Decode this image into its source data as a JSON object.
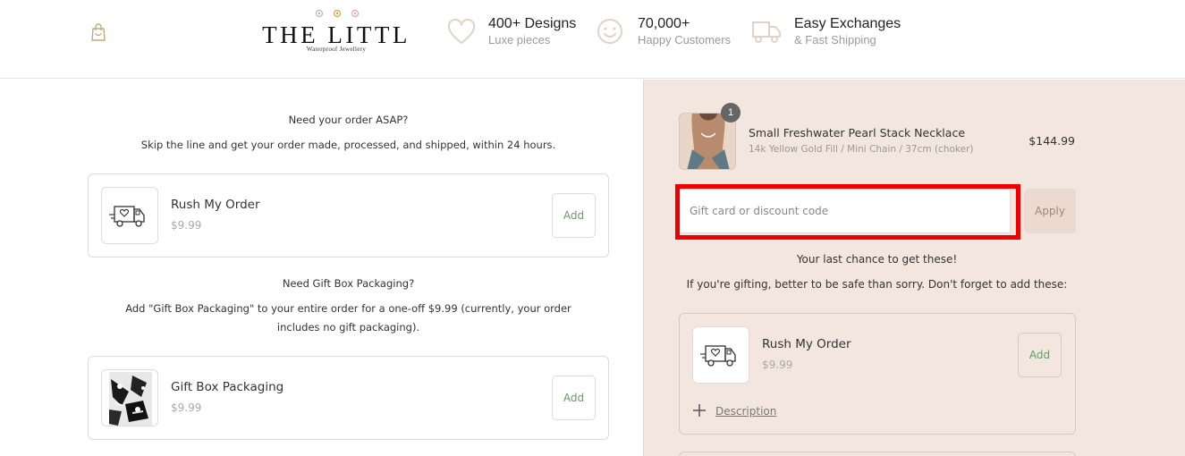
{
  "header": {
    "logo": {
      "wordmark": "THE LITTL",
      "tagline": "Waterproof Jewellery"
    },
    "features": [
      {
        "icon": "heart-icon",
        "title": "400+ Designs",
        "subtitle": "Luxe pieces"
      },
      {
        "icon": "smiley-icon",
        "title": "70,000+",
        "subtitle": "Happy Customers"
      },
      {
        "icon": "truck-icon",
        "title": "Easy Exchanges",
        "subtitle": "& Fast Shipping"
      }
    ]
  },
  "left": {
    "rush_heading": "Need your order ASAP?",
    "rush_text": "Skip the line and get your order made, processed, and shipped, within 24 hours.",
    "rush_item": {
      "name": "Rush My Order",
      "price": "$9.99",
      "add_label": "Add"
    },
    "gift_heading": "Need Gift Box Packaging?",
    "gift_text": "Add \"Gift Box Packaging\" to your entire order for a one-off $9.99 (currently, your order includes no gift packaging).",
    "gift_item": {
      "name": "Gift Box Packaging",
      "price": "$9.99",
      "add_label": "Add"
    }
  },
  "summary": {
    "product": {
      "quantity": "1",
      "name": "Small Freshwater Pearl Stack Necklace",
      "variant": "14k Yellow Gold Fill / Mini Chain / 37cm (choker)",
      "price": "$144.99"
    },
    "discount": {
      "placeholder": "Gift card or discount code",
      "apply_label": "Apply"
    },
    "last_chance": "Your last chance to get these!",
    "gifting_note": "If you're gifting, better to be safe than sorry. Don't forget to add these:",
    "upsell": {
      "name": "Rush My Order",
      "price": "$9.99",
      "add_label": "Add",
      "description_label": "Description"
    }
  },
  "colors": {
    "accent_green": "#6a9a6a",
    "summary_bg": "#f3e6df",
    "highlight_red": "#ee0000",
    "brand_gold": "#c9a77a"
  }
}
